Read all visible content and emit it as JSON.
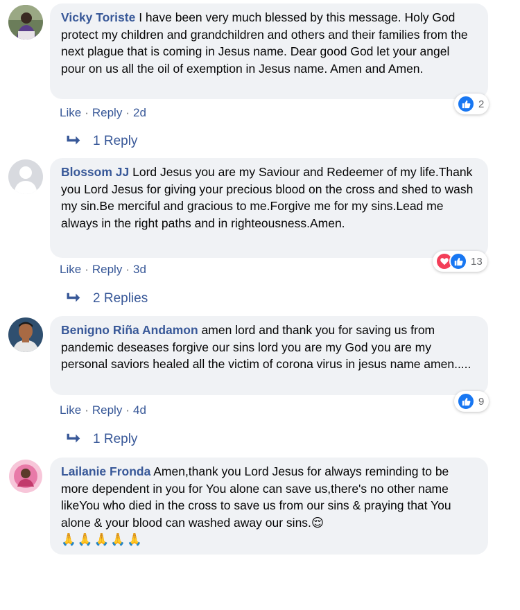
{
  "comments": [
    {
      "author": "Vicky Toriste",
      "text": "I have been very much blessed by this message. Holy God protect my children and grandchildren and others and their families from the next plague that is coming in Jesus name. Dear good God let your angel pour on us all the oil of exemption in Jesus name. Amen and Amen.",
      "like_label": "Like",
      "reply_label": "Reply",
      "time": "2d",
      "reaction_icons": [
        "like-icon"
      ],
      "reaction_count": "2",
      "replies_label": "1 Reply"
    },
    {
      "author": "Blossom JJ",
      "text": "Lord Jesus you are my Saviour and Redeemer of my life.Thank you Lord Jesus for giving your precious blood on the cross and shed to wash my sin.Be merciful and gracious to me.Forgive me for my sins.Lead me always in the right paths and in righteousness.Amen.",
      "like_label": "Like",
      "reply_label": "Reply",
      "time": "3d",
      "reaction_icons": [
        "love-icon",
        "like-icon"
      ],
      "reaction_count": "13",
      "replies_label": "2 Replies"
    },
    {
      "author": "Benigno Riña Andamon",
      "text": "amen lord and thank you for saving us from pandemic deseases forgive our sins lord you are my God you are my personal saviors healed all the victim of corona virus in jesus name amen.....",
      "like_label": "Like",
      "reply_label": "Reply",
      "time": "4d",
      "reaction_icons": [
        "like-icon"
      ],
      "reaction_count": "9",
      "replies_label": "1 Reply"
    },
    {
      "author": "Lailanie Fronda",
      "text": "Amen,thank you Lord Jesus for always reminding to be more dependent in you for You alone can save us,there's no other name likeYou who died in the cross to save us from our sins & praying that You alone & your blood can washed away our sins.",
      "emoji_trail": "😌",
      "emoji_line": "🙏🙏🙏🙏🙏"
    }
  ],
  "colors": {
    "link": "#385898",
    "bubble": "#f0f2f5",
    "like": "#1877f2",
    "love": "#f33e58"
  }
}
